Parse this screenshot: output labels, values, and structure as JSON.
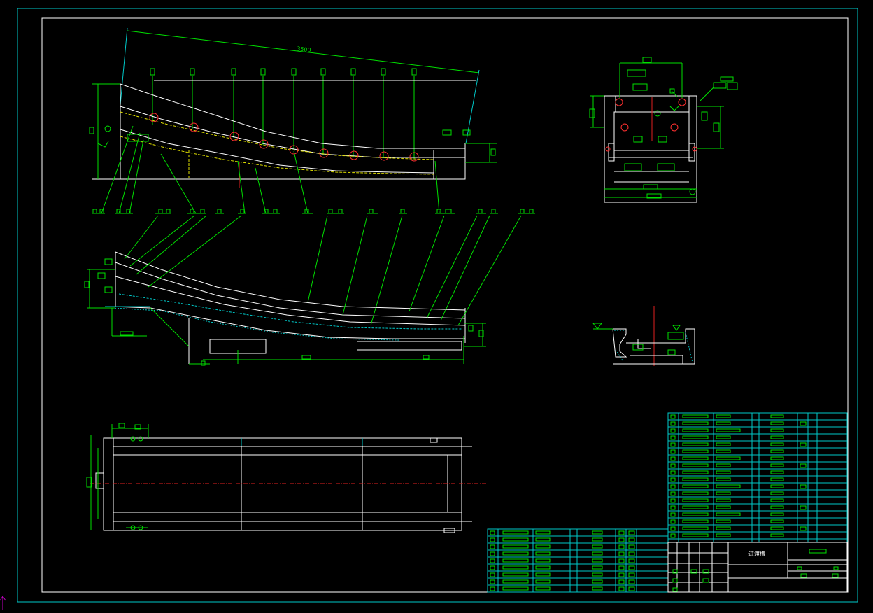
{
  "drawing": {
    "title_block_name": "过渡槽",
    "overall_dimension": "3500",
    "colors": {
      "background": "#000000",
      "frame": "#00c8c8",
      "border": "#ffffff",
      "outline": "#ffffff",
      "dimension": "#00e000",
      "centerline": "#e02020",
      "hidden": "#e0e000",
      "ucs_icon": "#c000c0"
    },
    "views": [
      "side-elevation",
      "section-view",
      "end-view",
      "detail-section",
      "plan-view"
    ],
    "tables": [
      "parts-list",
      "title-block",
      "notes-table"
    ]
  }
}
